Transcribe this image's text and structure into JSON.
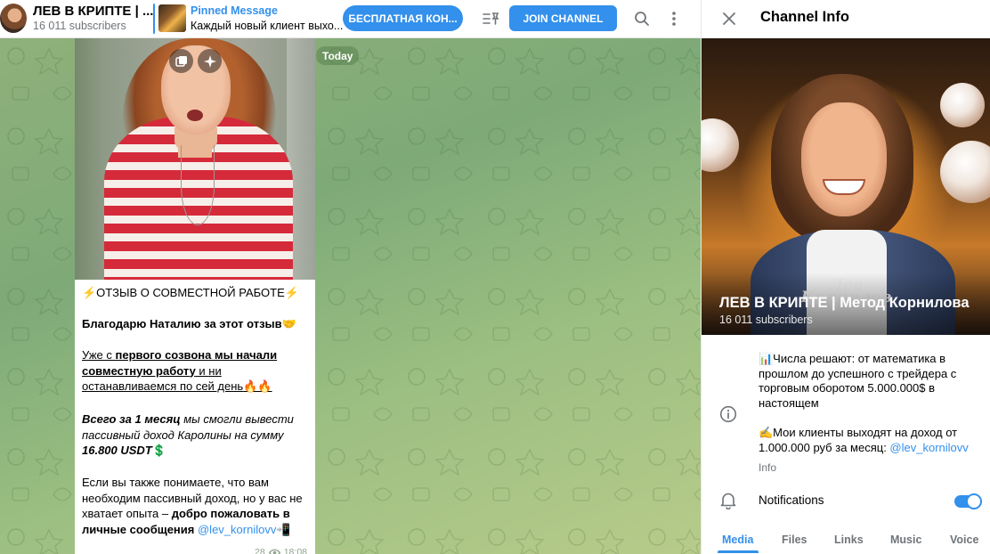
{
  "header": {
    "channel_title": "ЛЕВ В КРИПТЕ | ...",
    "subscribers": "16 011 subscribers",
    "pinned_title": "Pinned Message",
    "pinned_text": "Каждый новый клиент выхо...",
    "free_button": "БЕСПЛАТНАЯ КОН...",
    "join_button": "JOIN CHANNEL"
  },
  "chat": {
    "date_chip": "Today",
    "message": {
      "heading": "⚡ОТЗЫВ О СОВМЕСТНОЙ РАБОТЕ⚡",
      "thanks": "Благодарю Наталию за этот отзыв🤝",
      "p2_a": "Уже с ",
      "p2_b": "первого созвона мы начали совместную работу",
      "p2_c": " и ни останавливаемся по сей день",
      "p2_emoji": "🔥🔥",
      "p3_a": "Всего за 1 месяц",
      "p3_b": " мы смогли вывести пассивный доход Каролины на сумму ",
      "p3_c": "16.800 USDT",
      "p3_emoji": "💲",
      "p4_a": "Если вы также понимаете, что вам необходим пассивный доход, но у вас не хватает опыта – ",
      "p4_b": "добро пожаловать в личные сообщения ",
      "p4_link": "@lev_kornilovv",
      "p4_emoji": "📲",
      "views": "28",
      "time": "18:08"
    }
  },
  "panel": {
    "title": "Channel Info",
    "cover_name": "ЛЕВ В КРИПТЕ | Метод Корнилова",
    "cover_subs": "16 011 subscribers",
    "cover_sign": "Лев\nКорнилов",
    "desc_1": "📊Числа решают: от математика в прошлом до успешного с трейдера с торговым оборотом 5.000.000$ в настоящем",
    "desc_2a": "✍Мои клиенты выходят на доход от 1.000.000 руб за месяц: ",
    "desc_2_link": "@lev_kornilovv",
    "info_label": "Info",
    "notifications_label": "Notifications",
    "notifications_on": true,
    "tabs": [
      "Media",
      "Files",
      "Links",
      "Music",
      "Voice"
    ],
    "active_tab": "Media"
  },
  "colors": {
    "accent": "#3390ec",
    "secondary_text": "#707579",
    "shirt_red": "#d52a3a"
  }
}
